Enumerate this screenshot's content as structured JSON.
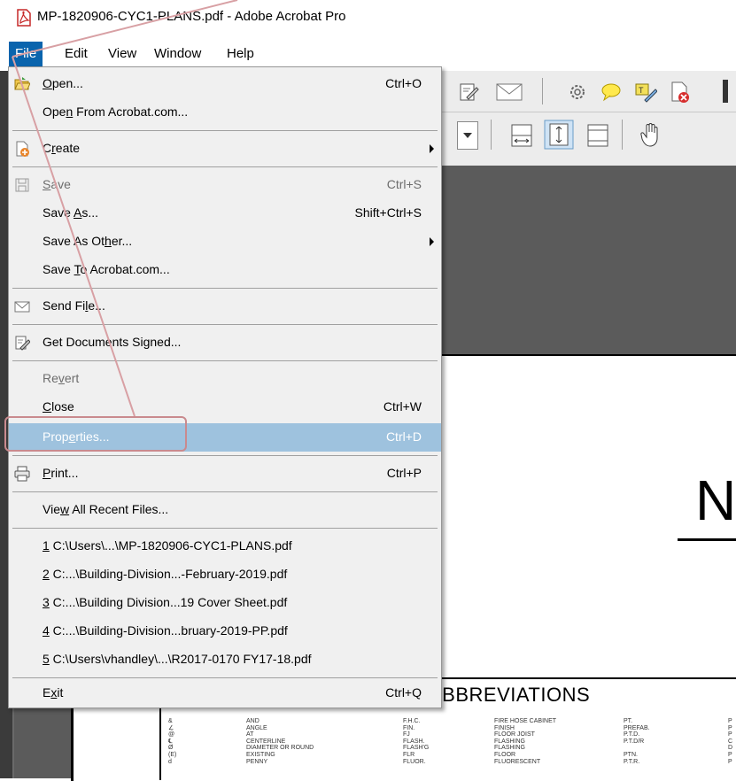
{
  "window": {
    "title": "MP-1820906-CYC1-PLANS.pdf - Adobe Acrobat Pro"
  },
  "menubar": {
    "items": [
      "File",
      "Edit",
      "View",
      "Window",
      "Help"
    ],
    "active": "File"
  },
  "file_menu": {
    "open": {
      "label": "Open...",
      "shortcut": "Ctrl+O",
      "icon": "open-folder-icon"
    },
    "open_from_acrobat": {
      "label": "Open From Acrobat.com..."
    },
    "create": {
      "label": "Create",
      "icon": "create-pdf-icon",
      "submenu": true
    },
    "save": {
      "label": "Save",
      "shortcut": "Ctrl+S",
      "icon": "save-disk-icon",
      "disabled": true
    },
    "save_as": {
      "label": "Save As...",
      "shortcut": "Shift+Ctrl+S"
    },
    "save_as_other": {
      "label": "Save As Other...",
      "submenu": true
    },
    "save_to_acrobat": {
      "label": "Save To Acrobat.com..."
    },
    "send_file": {
      "label": "Send File...",
      "icon": "envelope-icon"
    },
    "get_signed": {
      "label": "Get Documents Signed...",
      "icon": "sign-pen-icon"
    },
    "revert": {
      "label": "Revert",
      "disabled": true
    },
    "close": {
      "label": "Close",
      "shortcut": "Ctrl+W"
    },
    "properties": {
      "label": "Properties...",
      "shortcut": "Ctrl+D",
      "highlighted": true
    },
    "print": {
      "label": "Print...",
      "shortcut": "Ctrl+P",
      "icon": "printer-icon"
    },
    "view_recent": {
      "label": "View All Recent Files..."
    },
    "recent_files": [
      "1 C:\\Users\\...\\MP-1820906-CYC1-PLANS.pdf",
      "2 C:...\\Building-Division...-February-2019.pdf",
      "3 C:...\\Building Division...19 Cover Sheet.pdf",
      "4 C:...\\Building-Division...bruary-2019-PP.pdf",
      "5 C:\\Users\\vhandley\\...\\R2017-0170 FY17-18.pdf"
    ],
    "exit": {
      "label": "Exit",
      "shortcut": "Ctrl+Q"
    }
  },
  "document": {
    "large_letter": "N",
    "abbreviations_title": "ABBREVIATIONS",
    "col_symbols": "&\n∠\n@\n℄\nØ\n(E)\nd",
    "col_meanings": "AND\nANGLE\nAT\nCENTERLINE\nDIAMETER OR ROUND\nEXISTING\nPENNY",
    "col_abbr2": "F.H.C.\nFIN.\nFJ\nFLASH.\nFLASH'G\nFLR\nFLUOR.",
    "col_meanings2": "FIRE HOSE CABINET\nFINISH\nFLOOR JOIST\nFLASHING\nFLASHING\nFLOOR\nFLUORESCENT",
    "col_abbr3": "PT.\nPREFAB.\nP.T.D.\nP.T.D/R\n\nPTN.\nP.T.R.",
    "col_abbr4": "P\nP\nP\nC\nD\nP\nP"
  },
  "colors": {
    "menu_highlight": "#9ec2de",
    "file_menu_active": "#0a64ad",
    "callout": "#c98a8e"
  }
}
